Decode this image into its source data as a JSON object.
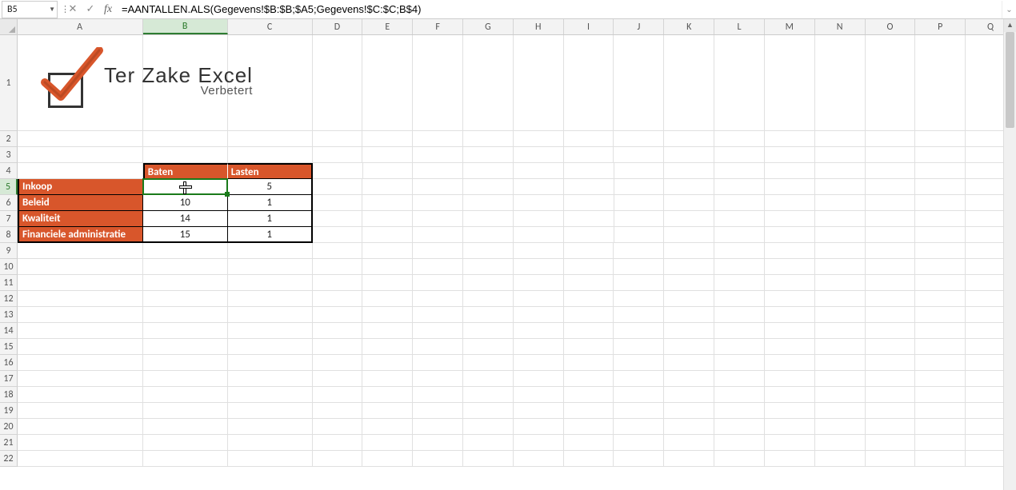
{
  "formula_bar": {
    "cell_ref": "B5",
    "cancel_glyph": "✕",
    "enter_glyph": "✓",
    "fx_label": "fx",
    "formula": "=AANTALLEN.ALS(Gegevens!$B:$B;$A5;Gegevens!$C:$C;B$4)",
    "expand_glyph": "⌄"
  },
  "columns": [
    "A",
    "B",
    "C",
    "D",
    "E",
    "F",
    "G",
    "H",
    "I",
    "J",
    "K",
    "L",
    "M",
    "N",
    "O",
    "P",
    "Q"
  ],
  "selected_col_index": 1,
  "row_headers": [
    1,
    2,
    3,
    4,
    5,
    6,
    7,
    8,
    9,
    10,
    11,
    12,
    13,
    14,
    15,
    16,
    17,
    18,
    19,
    20,
    21,
    22
  ],
  "selected_row_index": 4,
  "table": {
    "col_headers": [
      "Baten",
      "Lasten"
    ],
    "row_headers": [
      "Inkoop",
      "Beleid",
      "Kwaliteit",
      "Financiele administratie"
    ],
    "data": [
      [
        "",
        "5"
      ],
      [
        "10",
        "1"
      ],
      [
        "14",
        "1"
      ],
      [
        "15",
        "1"
      ]
    ]
  },
  "logo": {
    "title": "Ter Zake Excel",
    "subtitle": "Verbetert"
  },
  "colors": {
    "header_bg": "#D8562B",
    "selection_green": "#1a7a1a"
  }
}
